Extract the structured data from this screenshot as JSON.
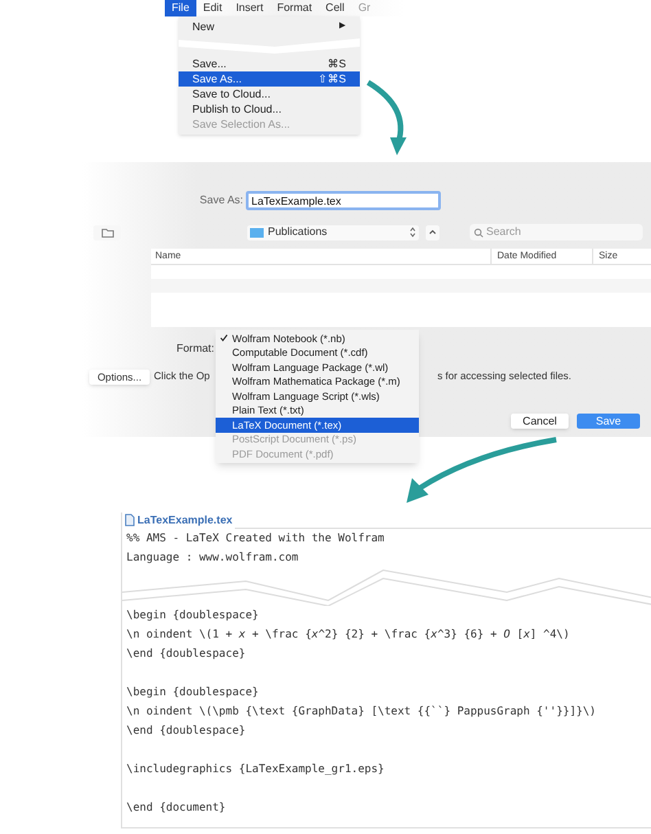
{
  "menu_bar": [
    {
      "label": "File",
      "selected": true,
      "disabled": false
    },
    {
      "label": "Edit",
      "selected": false,
      "disabled": false
    },
    {
      "label": "Insert",
      "selected": false,
      "disabled": false
    },
    {
      "label": "Format",
      "selected": false,
      "disabled": false
    },
    {
      "label": "Cell",
      "selected": false,
      "disabled": false
    },
    {
      "label": "Gr",
      "selected": false,
      "disabled": true
    }
  ],
  "menu_top": [
    {
      "label": "New",
      "shortcut": "▶",
      "selected": false,
      "disabled": false
    }
  ],
  "menu_items": [
    {
      "label": "Save...",
      "shortcut": "⌘S",
      "selected": false,
      "disabled": false
    },
    {
      "label": "Save As...",
      "shortcut": "⇧⌘S",
      "selected": true,
      "disabled": false
    },
    {
      "label": "Save to Cloud...",
      "selected": false,
      "disabled": false
    },
    {
      "label": "Publish to Cloud...",
      "selected": false,
      "disabled": false
    },
    {
      "label": "Save Selection As...",
      "selected": false,
      "disabled": true
    }
  ],
  "dialog": {
    "save_as_label": "Save As:",
    "filename": "LaTexExample.tex",
    "location": "Publications",
    "search_placeholder": "Search",
    "columns": [
      "Name",
      "Date Modified",
      "Size"
    ],
    "format_label": "Format:",
    "options_button": "Options...",
    "hint_start": "Click the Op",
    "hint_end": "s for accessing selected files.",
    "cancel_button": "Cancel",
    "save_button": "Save",
    "format_options": [
      {
        "label": "Wolfram Notebook (*.nb)",
        "checked": true,
        "selected": false,
        "disabled": false
      },
      {
        "label": "Computable Document (*.cdf)",
        "checked": false,
        "selected": false,
        "disabled": false
      },
      {
        "label": "Wolfram Language Package (*.wl)",
        "checked": false,
        "selected": false,
        "disabled": false
      },
      {
        "label": "Wolfram Mathematica Package (*.m)",
        "checked": false,
        "selected": false,
        "disabled": false
      },
      {
        "label": "Wolfram Language Script (*.wls)",
        "checked": false,
        "selected": false,
        "disabled": false
      },
      {
        "label": "Plain Text (*.txt)",
        "checked": false,
        "selected": false,
        "disabled": false
      },
      {
        "label": "LaTeX Document (*.tex)",
        "checked": false,
        "selected": true,
        "disabled": false
      },
      {
        "label": "PostScript Document (*.ps)",
        "checked": false,
        "selected": false,
        "disabled": true
      },
      {
        "label": "PDF Document (*.pdf)",
        "checked": false,
        "selected": false,
        "disabled": true
      }
    ]
  },
  "document": {
    "title": "LaTexExample.tex",
    "blocks": [
      [
        "%% AMS - LaTeX Created with the Wolfram",
        "Language : www.wolfram.com"
      ],
      [
        "\\begin {doublespace}",
        "\\n oindent \\(1 + *x* + \\frac {*x*^2} {2} + \\frac {*x*^3} {6} + *O* [*x*] ^4\\)",
        "\\end {doublespace}"
      ],
      [
        "\\begin {doublespace}",
        "\\n oindent \\(\\pmb {\\text {GraphData} [\\text {{``} PappusGraph {''}}]}\\)",
        "\\end {doublespace}"
      ],
      [
        "\\includegraphics {LaTexExample_gr1.eps}"
      ],
      [
        "\\end {document}"
      ]
    ]
  }
}
